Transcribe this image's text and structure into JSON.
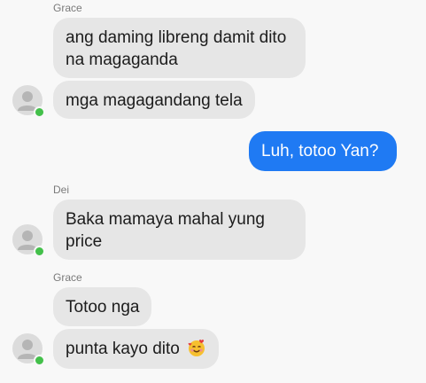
{
  "messages": [
    {
      "sender": "Grace",
      "lines": [
        "ang daming libreng damit dito",
        "na magaganda"
      ]
    },
    {
      "text": "mga magagandang tela"
    },
    {
      "text": "Luh, totoo Yan?"
    },
    {
      "sender": "Dei",
      "lines": [
        "Baka mamaya mahal yung",
        "price"
      ]
    },
    {
      "sender": "Grace",
      "text": "Totoo nga"
    },
    {
      "text": "punta kayo dito",
      "emoji": "smiling-face-with-hearts-icon"
    }
  ],
  "colors": {
    "background": "#f8f8f8",
    "incoming_bubble": "#e6e6e6",
    "outgoing_bubble": "#1f7af3",
    "online": "#43c04a"
  }
}
